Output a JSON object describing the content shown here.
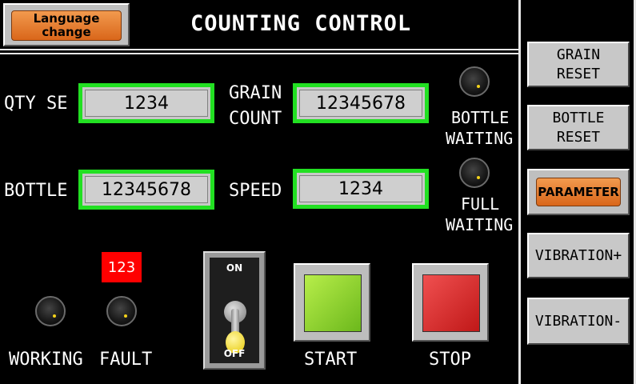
{
  "header": {
    "language_button": "Language change",
    "title": "COUNTING CONTROL"
  },
  "fields": {
    "qty_se": {
      "label": "QTY SE",
      "value": "1234"
    },
    "grain_count": {
      "label_line1": "GRAIN",
      "label_line2": "COUNT",
      "value": "12345678"
    },
    "bottle": {
      "label": "BOTTLE",
      "value": "12345678"
    },
    "speed": {
      "label": "SPEED",
      "value": "1234"
    }
  },
  "indicators": {
    "bottle_waiting": {
      "line1": "BOTTLE",
      "line2": "WAITING"
    },
    "full_waiting": {
      "line1": "FULL",
      "line2": "WAITING"
    },
    "working": "WORKING",
    "fault": "FAULT",
    "fault_code": "123"
  },
  "toggle": {
    "on": "ON",
    "off": "OFF",
    "state": "off"
  },
  "controls": {
    "start": "START",
    "stop": "STOP"
  },
  "sidebar": {
    "grain_reset": {
      "line1": "GRAIN",
      "line2": "RESET"
    },
    "bottle_reset": {
      "line1": "BOTTLE",
      "line2": "RESET"
    },
    "parameter": "PARAMETER",
    "vibration_plus": "VIBRATION+",
    "vibration_minus": "VIBRATION-"
  },
  "colors": {
    "field_border": "#22e022",
    "accent_button": "#e07a2e",
    "fault_badge": "#ff0000",
    "start": "#8fd62c",
    "stop": "#e03030",
    "background": "#000000"
  }
}
